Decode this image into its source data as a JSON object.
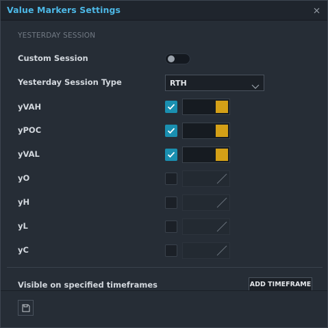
{
  "dialog": {
    "title": "Value Markers Settings",
    "close_icon": "close-icon"
  },
  "section": {
    "title": "YESTERDAY SESSION"
  },
  "custom_session": {
    "label": "Custom Session",
    "enabled": false
  },
  "session_type": {
    "label": "Yesterday Session Type",
    "value": "RTH"
  },
  "markers": [
    {
      "label": "yVAH",
      "checked": true,
      "color": "#d4a017"
    },
    {
      "label": "yPOC",
      "checked": true,
      "color": "#d4a017"
    },
    {
      "label": "yVAL",
      "checked": true,
      "color": "#d4a017"
    },
    {
      "label": "yO",
      "checked": false,
      "color": null
    },
    {
      "label": "yH",
      "checked": false,
      "color": null
    },
    {
      "label": "yL",
      "checked": false,
      "color": null
    },
    {
      "label": "yC",
      "checked": false,
      "color": null
    }
  ],
  "timeframes": {
    "label": "Visible on specified timeframes",
    "add_button": "ADD TIMEFRAME"
  },
  "footer": {
    "save_icon": "save-icon"
  },
  "colors": {
    "accent": "#4db8e6",
    "checkbox_on": "#1a8fb0",
    "marker_color": "#d4a017"
  }
}
